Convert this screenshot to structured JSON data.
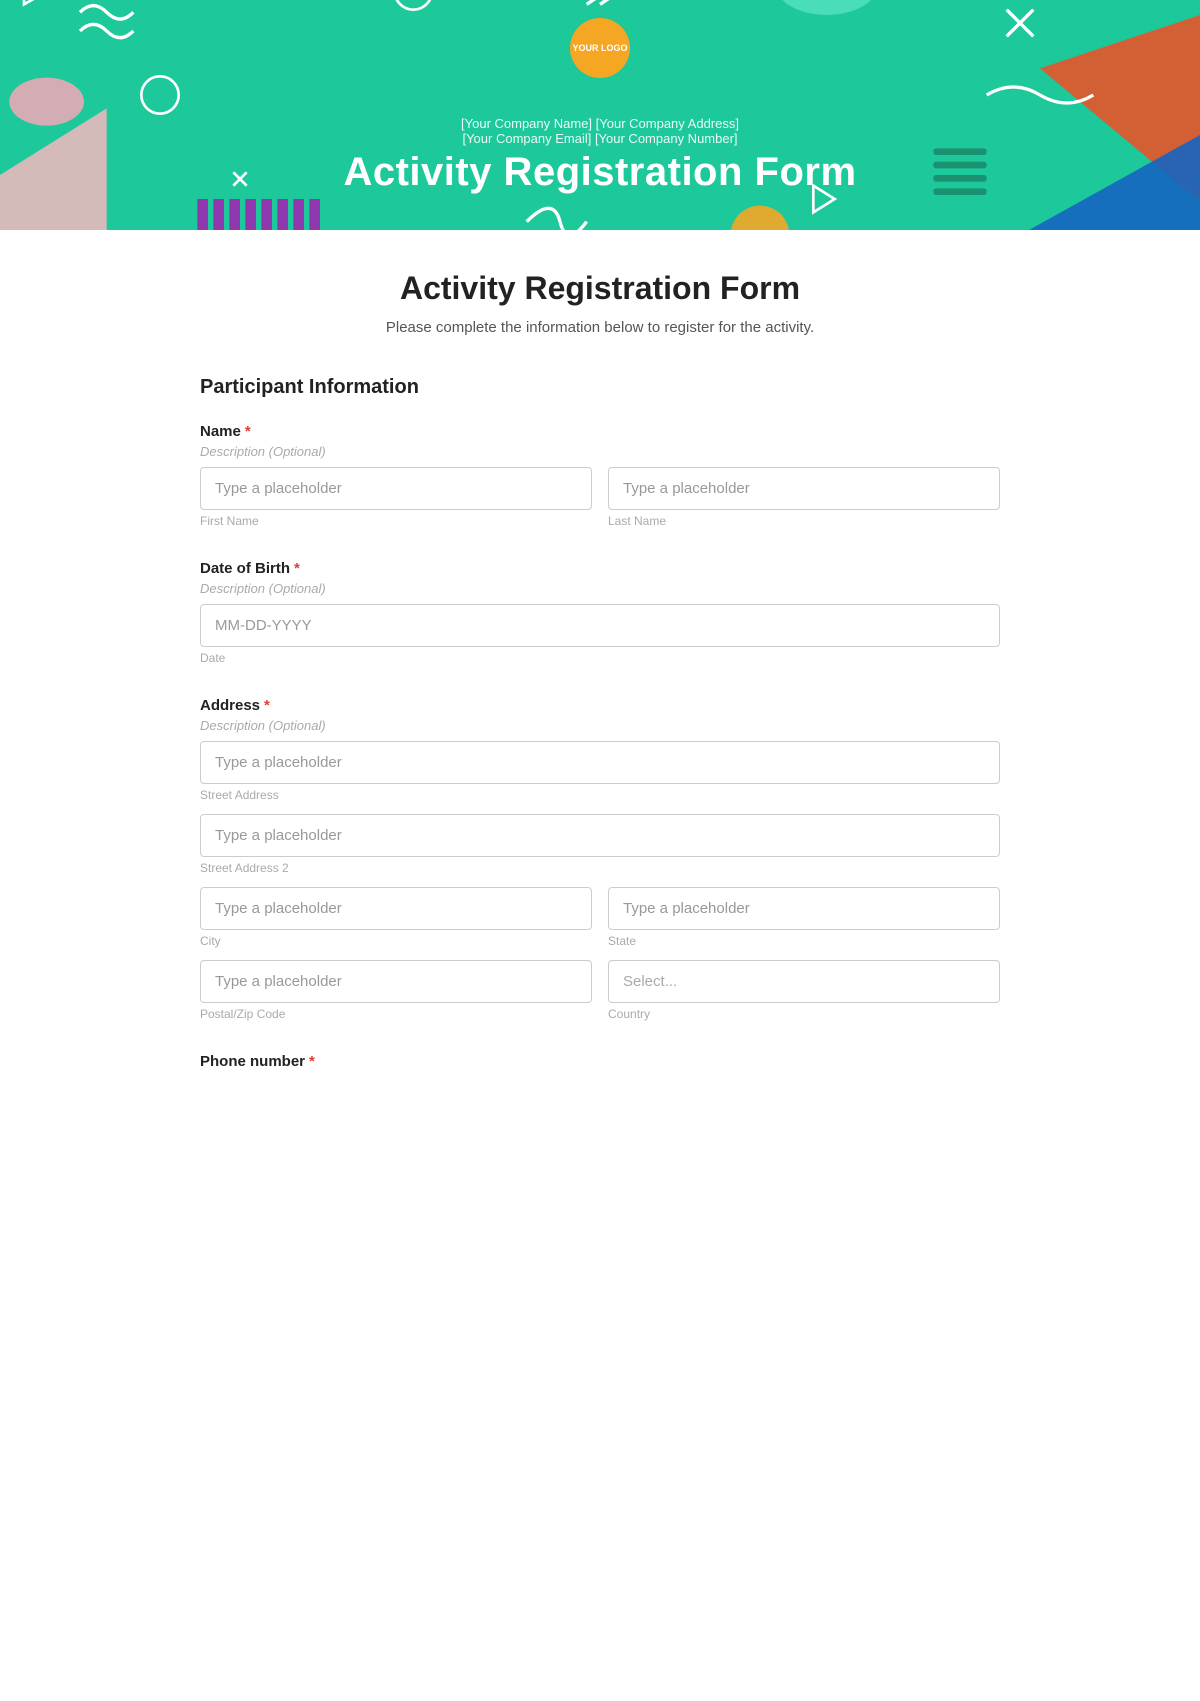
{
  "banner": {
    "logo_text": "YOUR\nLOGO",
    "company_name": "[Your Company Name] [Your Company Address]",
    "company_email": "[Your Company Email] [Your Company Number]",
    "title": "Activity Registration Form"
  },
  "form": {
    "title": "Activity Registration Form",
    "subtitle": "Please complete the information below to register for the activity.",
    "section_participant": "Participant Information",
    "fields": {
      "name": {
        "label": "Name",
        "required": true,
        "description": "Description (Optional)",
        "first_placeholder": "Type a placeholder",
        "last_placeholder": "Type a placeholder",
        "first_sublabel": "First Name",
        "last_sublabel": "Last Name"
      },
      "dob": {
        "label": "Date of Birth",
        "required": true,
        "description": "Description (Optional)",
        "placeholder": "MM-DD-YYYY",
        "sublabel": "Date"
      },
      "address": {
        "label": "Address",
        "required": true,
        "description": "Description (Optional)",
        "street1_placeholder": "Type a placeholder",
        "street1_sublabel": "Street Address",
        "street2_placeholder": "Type a placeholder",
        "street2_sublabel": "Street Address 2",
        "city_placeholder": "Type a placeholder",
        "city_sublabel": "City",
        "state_placeholder": "Type a placeholder",
        "state_sublabel": "State",
        "postal_placeholder": "Type a placeholder",
        "postal_sublabel": "Postal/Zip Code",
        "country_placeholder": "Select...",
        "country_sublabel": "Country"
      },
      "phone": {
        "label": "Phone number",
        "required": true
      }
    }
  }
}
